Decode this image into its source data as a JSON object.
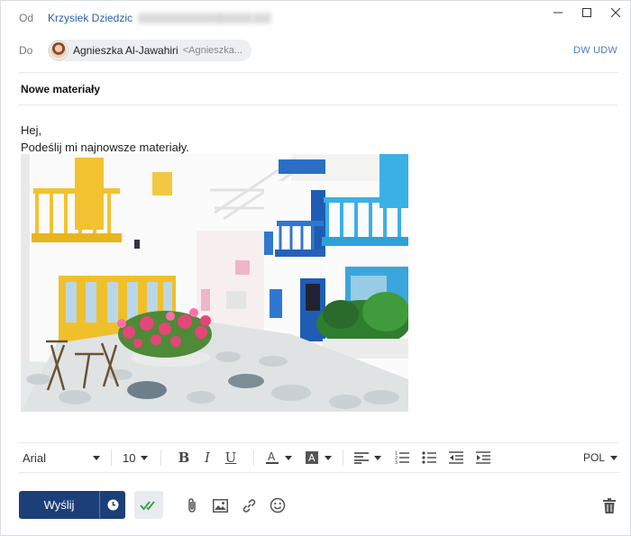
{
  "header": {
    "from_label": "Od",
    "from_name": "Krzysiek Dziedzic",
    "from_email": "xxxxxxxxxxxxxx@xxxxx.xxx",
    "to_label": "Do",
    "recipient_name": "Agnieszka Al-Jawahiri",
    "recipient_email": "<Agnieszka...",
    "cc_bcc": "DW UDW"
  },
  "subject": "Nowe materiały",
  "body": {
    "line1": "Hej,",
    "line2": "Podeślij mi najnowsze materiały."
  },
  "toolbar": {
    "font": "Arial",
    "size": "10",
    "bold": "B",
    "italic": "I",
    "underline": "U",
    "language": "POL"
  },
  "actions": {
    "send_label": "Wyślij"
  },
  "colors": {
    "primary": "#1d3f78",
    "link": "#2a5ea8",
    "check": "#2e9e4a"
  }
}
